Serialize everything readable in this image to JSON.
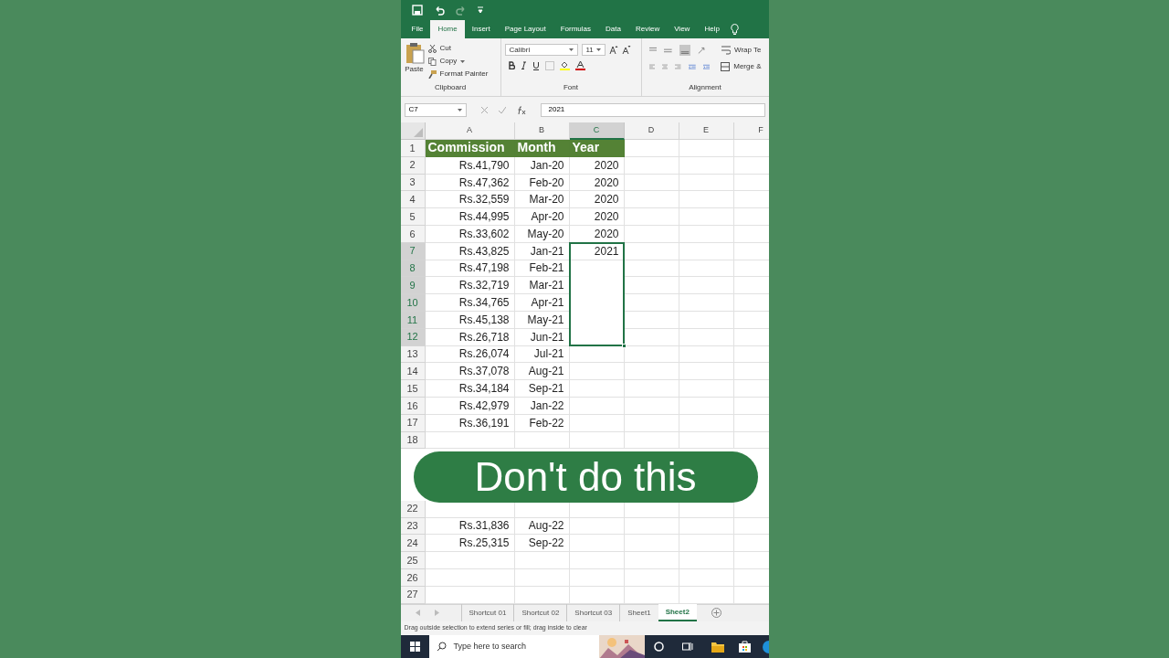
{
  "ribbon_tabs": [
    {
      "label": "File",
      "selected": false
    },
    {
      "label": "Home",
      "selected": true
    },
    {
      "label": "Insert",
      "selected": false
    },
    {
      "label": "Page Layout",
      "selected": false
    },
    {
      "label": "Formulas",
      "selected": false
    },
    {
      "label": "Data",
      "selected": false
    },
    {
      "label": "Review",
      "selected": false
    },
    {
      "label": "View",
      "selected": false
    },
    {
      "label": "Help",
      "selected": false
    }
  ],
  "clipboard": {
    "paste": "Paste",
    "cut": "Cut",
    "copy": "Copy",
    "format_painter": "Format Painter",
    "group": "Clipboard"
  },
  "font": {
    "name": "Calibri",
    "size": "11",
    "group": "Font"
  },
  "alignment": {
    "wrap_text": "Wrap Te",
    "merge": "Merge &",
    "group": "Alignment"
  },
  "formula_bar": {
    "name_box": "C7",
    "value": "2021"
  },
  "columns": [
    {
      "label": "A",
      "selected": false
    },
    {
      "label": "B",
      "selected": false
    },
    {
      "label": "C",
      "selected": true
    },
    {
      "label": "D",
      "selected": false
    },
    {
      "label": "E",
      "selected": false
    },
    {
      "label": "F",
      "selected": false
    }
  ],
  "rows": [
    {
      "number": "1",
      "kind": "header",
      "selected": false,
      "cells": [
        "Commission",
        "Month",
        "Year"
      ]
    },
    {
      "number": "2",
      "kind": "data",
      "selected": false,
      "cells": [
        "Rs.41,790",
        "Jan-20",
        "2020"
      ]
    },
    {
      "number": "3",
      "kind": "data",
      "selected": false,
      "cells": [
        "Rs.47,362",
        "Feb-20",
        "2020"
      ]
    },
    {
      "number": "4",
      "kind": "data",
      "selected": false,
      "cells": [
        "Rs.32,559",
        "Mar-20",
        "2020"
      ]
    },
    {
      "number": "5",
      "kind": "data",
      "selected": false,
      "cells": [
        "Rs.44,995",
        "Apr-20",
        "2020"
      ]
    },
    {
      "number": "6",
      "kind": "data",
      "selected": false,
      "cells": [
        "Rs.33,602",
        "May-20",
        "2020"
      ]
    },
    {
      "number": "7",
      "kind": "data",
      "selected": true,
      "cells": [
        "Rs.43,825",
        "Jan-21",
        "2021"
      ]
    },
    {
      "number": "8",
      "kind": "data",
      "selected": true,
      "cells": [
        "Rs.47,198",
        "Feb-21",
        ""
      ]
    },
    {
      "number": "9",
      "kind": "data",
      "selected": true,
      "cells": [
        "Rs.32,719",
        "Mar-21",
        ""
      ]
    },
    {
      "number": "10",
      "kind": "data",
      "selected": true,
      "cells": [
        "Rs.34,765",
        "Apr-21",
        ""
      ]
    },
    {
      "number": "11",
      "kind": "data",
      "selected": true,
      "cells": [
        "Rs.45,138",
        "May-21",
        ""
      ]
    },
    {
      "number": "12",
      "kind": "data",
      "selected": true,
      "cells": [
        "Rs.26,718",
        "Jun-21",
        ""
      ]
    },
    {
      "number": "13",
      "kind": "data",
      "selected": false,
      "cells": [
        "Rs.26,074",
        "Jul-21",
        ""
      ]
    },
    {
      "number": "14",
      "kind": "data",
      "selected": false,
      "cells": [
        "Rs.37,078",
        "Aug-21",
        ""
      ]
    },
    {
      "number": "15",
      "kind": "data",
      "selected": false,
      "cells": [
        "Rs.34,184",
        "Sep-21",
        ""
      ]
    },
    {
      "number": "16",
      "kind": "data",
      "selected": false,
      "cells": [
        "Rs.42,979",
        "Jan-22",
        ""
      ]
    },
    {
      "number": "17",
      "kind": "data",
      "selected": false,
      "cells": [
        "Rs.36,191",
        "Feb-22",
        ""
      ]
    },
    {
      "number": "18",
      "kind": "data",
      "selected": false,
      "cells": [
        "",
        "",
        ""
      ]
    },
    {
      "kind": "covered"
    },
    {
      "kind": "covered"
    },
    {
      "kind": "covered"
    },
    {
      "number": "22",
      "kind": "data",
      "selected": false,
      "cells": [
        "",
        "",
        ""
      ]
    },
    {
      "number": "23",
      "kind": "data",
      "selected": false,
      "cells": [
        "Rs.31,836",
        "Aug-22",
        ""
      ]
    },
    {
      "number": "24",
      "kind": "data",
      "selected": false,
      "cells": [
        "Rs.25,315",
        "Sep-22",
        ""
      ]
    },
    {
      "number": "25",
      "kind": "data",
      "selected": false,
      "cells": [
        "",
        "",
        ""
      ]
    },
    {
      "number": "26",
      "kind": "data",
      "selected": false,
      "cells": [
        "",
        "",
        ""
      ]
    },
    {
      "number": "27",
      "kind": "data",
      "selected": false,
      "cells": [
        "",
        "",
        ""
      ]
    }
  ],
  "sheet_tabs": [
    {
      "label": "Shortcut 01",
      "selected": false
    },
    {
      "label": "Shortcut 02",
      "selected": false
    },
    {
      "label": "Shortcut 03",
      "selected": false
    },
    {
      "label": "Sheet1",
      "selected": false
    },
    {
      "label": "Sheet2",
      "selected": true
    }
  ],
  "status_bar": "Drag outside selection to extend series or fill; drag inside to clear",
  "taskbar": {
    "search_placeholder": "Type here to search"
  },
  "overlay_caption": "Don't do this"
}
